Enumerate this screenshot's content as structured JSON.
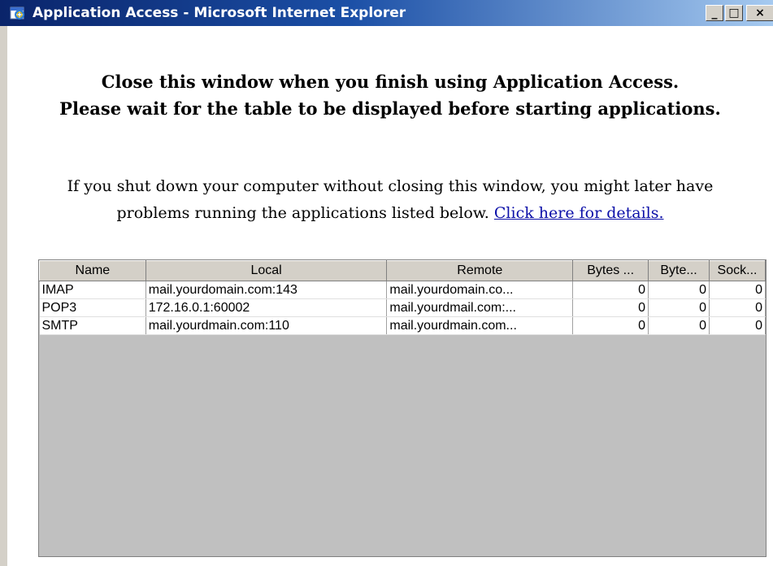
{
  "window": {
    "title": "Application Access - Microsoft Internet Explorer",
    "buttons": {
      "minimize": "_",
      "maximize": "□",
      "close": "×"
    }
  },
  "heading": {
    "line1": "Close this window when you finish using Application Access.",
    "line2": "Please wait for the table to be displayed before starting applications."
  },
  "warning": {
    "line1": "If you shut down your computer without closing this window, you might later have",
    "line2": "problems running the applications listed below.",
    "link": "Click here for details."
  },
  "table": {
    "columns": [
      "Name",
      "Local",
      "Remote",
      "Bytes ...",
      "Byte...",
      "Sock..."
    ],
    "rows": [
      [
        "IMAP",
        "mail.yourdomain.com:143",
        "mail.yourdomain.co...",
        "0",
        "0",
        "0"
      ],
      [
        "POP3",
        "172.16.0.1:60002",
        "mail.yourdmail.com:...",
        "0",
        "0",
        "0"
      ],
      [
        "SMTP",
        "mail.yourdmain.com:110",
        "mail.yourdmain.com...",
        "0",
        "0",
        "0"
      ]
    ]
  },
  "icons": {
    "app_icon": "internet-explorer-icon"
  },
  "colors": {
    "titlebar_start": "#0a246a",
    "titlebar_end": "#a6caf0",
    "link": "#0b0fa8",
    "table_empty": "#c0c0c0"
  }
}
